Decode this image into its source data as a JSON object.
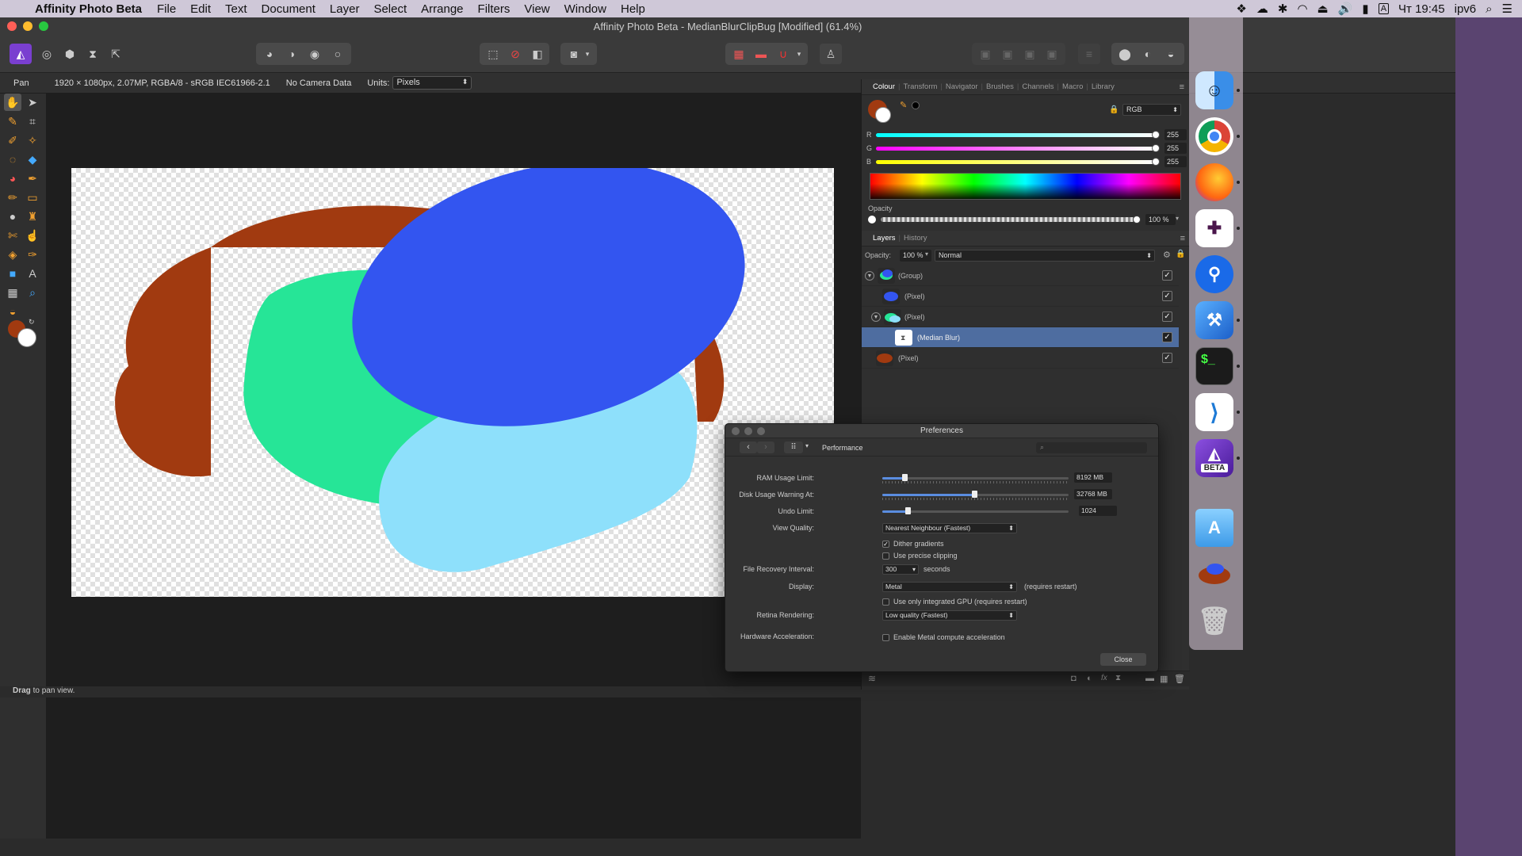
{
  "menubar": {
    "app_name": "Affinity Photo Beta",
    "items": [
      "File",
      "Edit",
      "Text",
      "Document",
      "Layer",
      "Select",
      "Arrange",
      "Filters",
      "View",
      "Window",
      "Help"
    ],
    "clock": "Чт 19:45",
    "network": "ipv6",
    "input_source": "A"
  },
  "window": {
    "title": "Affinity Photo Beta - MedianBlurClipBug [Modified] (61.4%)"
  },
  "context_toolbar": {
    "tool_name": "Pan",
    "doc_info": "1920 × 1080px, 2.07MP, RGBA/8 - sRGB IEC61966-2.1",
    "camera": "No Camera Data",
    "units_label": "Units:",
    "units_value": "Pixels"
  },
  "status": {
    "hint_bold": "Drag",
    "hint_text": "to pan view."
  },
  "colour_panel": {
    "tabs": [
      "Colour",
      "Transform",
      "Navigator",
      "Brushes",
      "Channels",
      "Macro",
      "Library"
    ],
    "active_tab": "Colour",
    "mode": "RGB",
    "r_label": "R",
    "r_value": "255",
    "g_label": "G",
    "g_value": "255",
    "b_label": "B",
    "b_value": "255",
    "opacity_label": "Opacity",
    "opacity_value": "100 %"
  },
  "layers_panel": {
    "tabs": [
      "Layers",
      "History"
    ],
    "active_tab": "Layers",
    "opacity_label": "Opacity:",
    "opacity_value": "100 %",
    "blend_mode": "Normal",
    "layers": [
      {
        "name": "(Group)",
        "checked": "✓"
      },
      {
        "name": "(Pixel)",
        "checked": "✓"
      },
      {
        "name": "(Pixel)",
        "checked": "✓"
      },
      {
        "name": "(Median Blur)",
        "checked": "✓"
      },
      {
        "name": "(Pixel)",
        "checked": "✓"
      }
    ]
  },
  "preferences": {
    "title": "Preferences",
    "section": "Performance",
    "ram_label": "RAM Usage Limit:",
    "ram_value": "8192 MB",
    "disk_label": "Disk Usage Warning At:",
    "disk_value": "32768 MB",
    "undo_label": "Undo Limit:",
    "undo_value": "1024",
    "view_quality_label": "View Quality:",
    "view_quality_value": "Nearest Neighbour (Fastest)",
    "dither_label": "Dither gradients",
    "precise_clip_label": "Use precise clipping",
    "recovery_label": "File Recovery Interval:",
    "recovery_value": "300",
    "recovery_unit": "seconds",
    "display_label": "Display:",
    "display_value": "Metal",
    "display_note": "(requires restart)",
    "integrated_gpu_label": "Use only integrated GPU (requires restart)",
    "retina_label": "Retina Rendering:",
    "retina_value": "Low quality (Fastest)",
    "hw_label": "Hardware Acceleration:",
    "hw_check_label": "Enable Metal compute acceleration",
    "close_label": "Close"
  },
  "dock": {
    "beta_label": "BETA"
  },
  "colors": {
    "blue_shape": "#3355f0",
    "green_shape": "#26e597",
    "lightblue_shape": "#8ee0fb",
    "brown_shape": "#a13a10",
    "selection": "#4e6da0"
  }
}
